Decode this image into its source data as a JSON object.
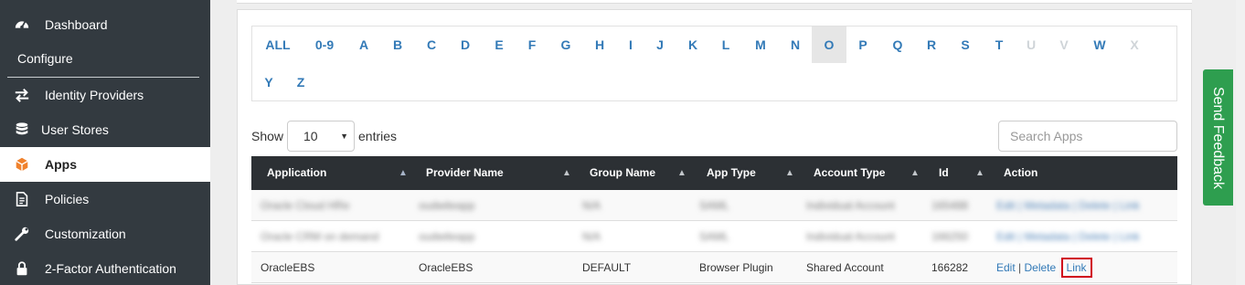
{
  "sidebar": {
    "items": [
      {
        "label": "Dashboard",
        "icon": "speedometer-icon"
      },
      {
        "label": "Identity Providers",
        "icon": "arrows-exchange-icon"
      },
      {
        "label": "User Stores",
        "icon": "database-icon"
      },
      {
        "label": "Apps",
        "icon": "cube-icon"
      },
      {
        "label": "Policies",
        "icon": "document-icon"
      },
      {
        "label": "Customization",
        "icon": "wrench-icon"
      },
      {
        "label": "2-Factor Authentication",
        "icon": "lock-icon"
      }
    ],
    "section_label": "Configure",
    "active": "Apps"
  },
  "alphabet": {
    "letters": [
      "ALL",
      "0-9",
      "A",
      "B",
      "C",
      "D",
      "E",
      "F",
      "G",
      "H",
      "I",
      "J",
      "K",
      "L",
      "M",
      "N",
      "O",
      "P",
      "Q",
      "R",
      "S",
      "T",
      "U",
      "V",
      "W",
      "X",
      "Y",
      "Z"
    ],
    "selected": "O",
    "disabled": [
      "U",
      "V",
      "X"
    ]
  },
  "controls": {
    "show_label": "Show",
    "entries_value": "10",
    "entries_label": "entries",
    "search_placeholder": "Search Apps"
  },
  "table": {
    "columns": [
      "Application",
      "Provider Name",
      "Group Name",
      "App Type",
      "Account Type",
      "Id",
      "Action"
    ],
    "rows": [
      {
        "application": "Oracle Cloud HRe",
        "provider": "oudwiteapp",
        "group": "N/A",
        "type": "SAML",
        "account": "Individual Account",
        "id": "165488",
        "action": "Edit | Metadata | Delete | Link",
        "blurred": true
      },
      {
        "application": "Oracle CRM on demand",
        "provider": "oudwiteapp",
        "group": "N/A",
        "type": "SAML",
        "account": "Individual Account",
        "id": "166250",
        "action": "Edit | Metadata | Delete | Link",
        "blurred": true
      },
      {
        "application": "OracleEBS",
        "provider": "OracleEBS",
        "group": "DEFAULT",
        "type": "Browser Plugin",
        "account": "Shared Account",
        "id": "166282",
        "blurred": false,
        "actions": {
          "edit": "Edit",
          "sep": "|",
          "delete": "Delete",
          "link": "Link"
        }
      }
    ]
  },
  "feedback": {
    "label": "Send Feedback"
  },
  "colors": {
    "sidebar": "#333a40",
    "header": "#2c3034",
    "link": "#337ab7",
    "feedback": "#2e9e4f",
    "highlight": "#d0021b"
  }
}
